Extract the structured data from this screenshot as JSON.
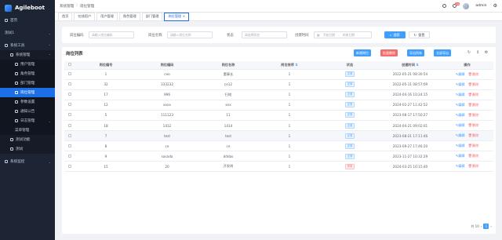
{
  "app": {
    "name": "Agileboot"
  },
  "sidebar": {
    "items": [
      {
        "label": "首页",
        "icon": "home-icon"
      },
      {
        "label": "测试1",
        "icon": ""
      },
      {
        "label": "系统工具",
        "icon": "tools-icon"
      },
      {
        "label": "系统管理",
        "icon": "setting-icon"
      },
      {
        "label": "用户管理",
        "icon": "user-icon"
      },
      {
        "label": "角色管理",
        "icon": "role-icon"
      },
      {
        "label": "部门管理",
        "icon": "dept-icon"
      },
      {
        "label": "岗位管理",
        "icon": "post-icon"
      },
      {
        "label": "参数设置",
        "icon": "param-icon"
      },
      {
        "label": "通知公告",
        "icon": "notice-icon"
      },
      {
        "label": "日志管理",
        "icon": "log-icon"
      },
      {
        "label": "菜单管理",
        "icon": ""
      },
      {
        "label": "测试功能",
        "icon": ""
      },
      {
        "label": "测试",
        "icon": ""
      },
      {
        "label": "系统监控",
        "icon": "monitor-icon"
      }
    ]
  },
  "header": {
    "breadcrumb": [
      "系统管理",
      "岗位管理"
    ],
    "notification_count": "19",
    "user": "admin"
  },
  "tabs": [
    {
      "label": "首页"
    },
    {
      "label": "在线用户"
    },
    {
      "label": "用户管理"
    },
    {
      "label": "角色管理"
    },
    {
      "label": "部门管理"
    },
    {
      "label": "岗位管理"
    }
  ],
  "search": {
    "code_label": "岗位编码",
    "code_placeholder": "请输入岗位编码",
    "name_label": "岗位名称",
    "name_placeholder": "请输入岗位名称",
    "status_label": "状态",
    "status_placeholder": "请选择状态",
    "time_label": "创建时间",
    "start_placeholder": "开始日期",
    "range_sep": "-",
    "end_placeholder": "结束日期",
    "search_btn": "搜索",
    "reset_btn": "重置"
  },
  "table": {
    "title": "岗位列表",
    "actions": {
      "add": "新增岗位",
      "batch_delete": "批量删除",
      "export_all": "导出所有",
      "export_page": "全部导出"
    },
    "columns": [
      "岗位编号",
      "岗位编码",
      "岗位名称",
      "岗位排序",
      "状态",
      "创建时间",
      "操作"
    ],
    "rows": [
      {
        "id": "1",
        "code": "ceo",
        "name": "董事长",
        "sort": "1",
        "status": "正常",
        "status_ok": true,
        "time": "2022-05-21 08:30:54"
      },
      {
        "id": "32",
        "code": "333232",
        "name": "ce12",
        "sort": "1",
        "status": "正常",
        "status_ok": true,
        "time": "2022-05-11 08:57:09"
      },
      {
        "id": "17",
        "code": "996",
        "name": "扫地",
        "sort": "1",
        "status": "正常",
        "status_ok": true,
        "time": "2024-04-16 10:24:15"
      },
      {
        "id": "12",
        "code": "xxxx",
        "name": "xxx",
        "sort": "1",
        "status": "正常",
        "status_ok": true,
        "time": "2024-02-27 11:42:52"
      },
      {
        "id": "5",
        "code": "111123",
        "name": "11",
        "sort": "1",
        "status": "正常",
        "status_ok": true,
        "time": "2023-08-17 17:50:27"
      },
      {
        "id": "18",
        "code": "1412",
        "name": "1414",
        "sort": "1",
        "status": "正常",
        "status_ok": true,
        "time": "2024-04-21 09:02:01"
      },
      {
        "id": "7",
        "code": "test",
        "name": "test",
        "sort": "1",
        "status": "正常",
        "status_ok": true,
        "time": "2023-08-21 17:11:46"
      },
      {
        "id": "8",
        "code": "ce",
        "name": "ce",
        "sort": "1",
        "status": "正常",
        "status_ok": true,
        "time": "2023-09-27 17:46:20"
      },
      {
        "id": "9",
        "code": "sasada",
        "name": "dddas",
        "sort": "1",
        "status": "正常",
        "status_ok": true,
        "time": "2023-11-27 10:32:29"
      },
      {
        "id": "15",
        "code": "20",
        "name": "开发岗",
        "sort": "1",
        "status": "停用",
        "status_ok": false,
        "time": "2024-03-25 16:15:40"
      }
    ],
    "edit_label": "编辑",
    "delete_label": "删除"
  },
  "pager": {
    "total_text": "共 10",
    "current": "1"
  },
  "colors": {
    "primary": "#409eff",
    "danger": "#f56c6c",
    "success": "#67c23a",
    "warning": "#e6a23c",
    "sidebar_bg": "#1d2433",
    "menu_active": "#1d6fe8"
  }
}
